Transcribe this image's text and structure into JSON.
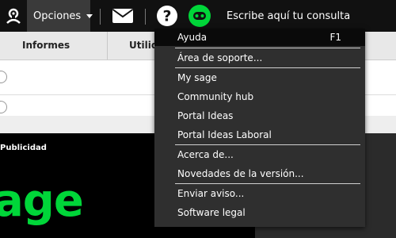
{
  "toolbar": {
    "options_label": "Opciones",
    "search_placeholder": "Escribe aquí tu consulta",
    "accent": "#00d639"
  },
  "table_header": {
    "col1": "Informes",
    "col2": "Utilid"
  },
  "sidebar": {
    "publicidad_label": "Publicidad",
    "brand_text": "age"
  },
  "menu": {
    "items": [
      {
        "label": "Ayuda",
        "shortcut": "F1"
      },
      {
        "label": "Área de soporte..."
      },
      {
        "label": "My sage"
      },
      {
        "label": "Community hub"
      },
      {
        "label": "Portal Ideas"
      },
      {
        "label": "Portal Ideas Laboral"
      },
      {
        "label": "Acerca de..."
      },
      {
        "label": "Novedades de la versión..."
      },
      {
        "label": "Enviar aviso..."
      },
      {
        "label": "Software legal"
      }
    ]
  }
}
